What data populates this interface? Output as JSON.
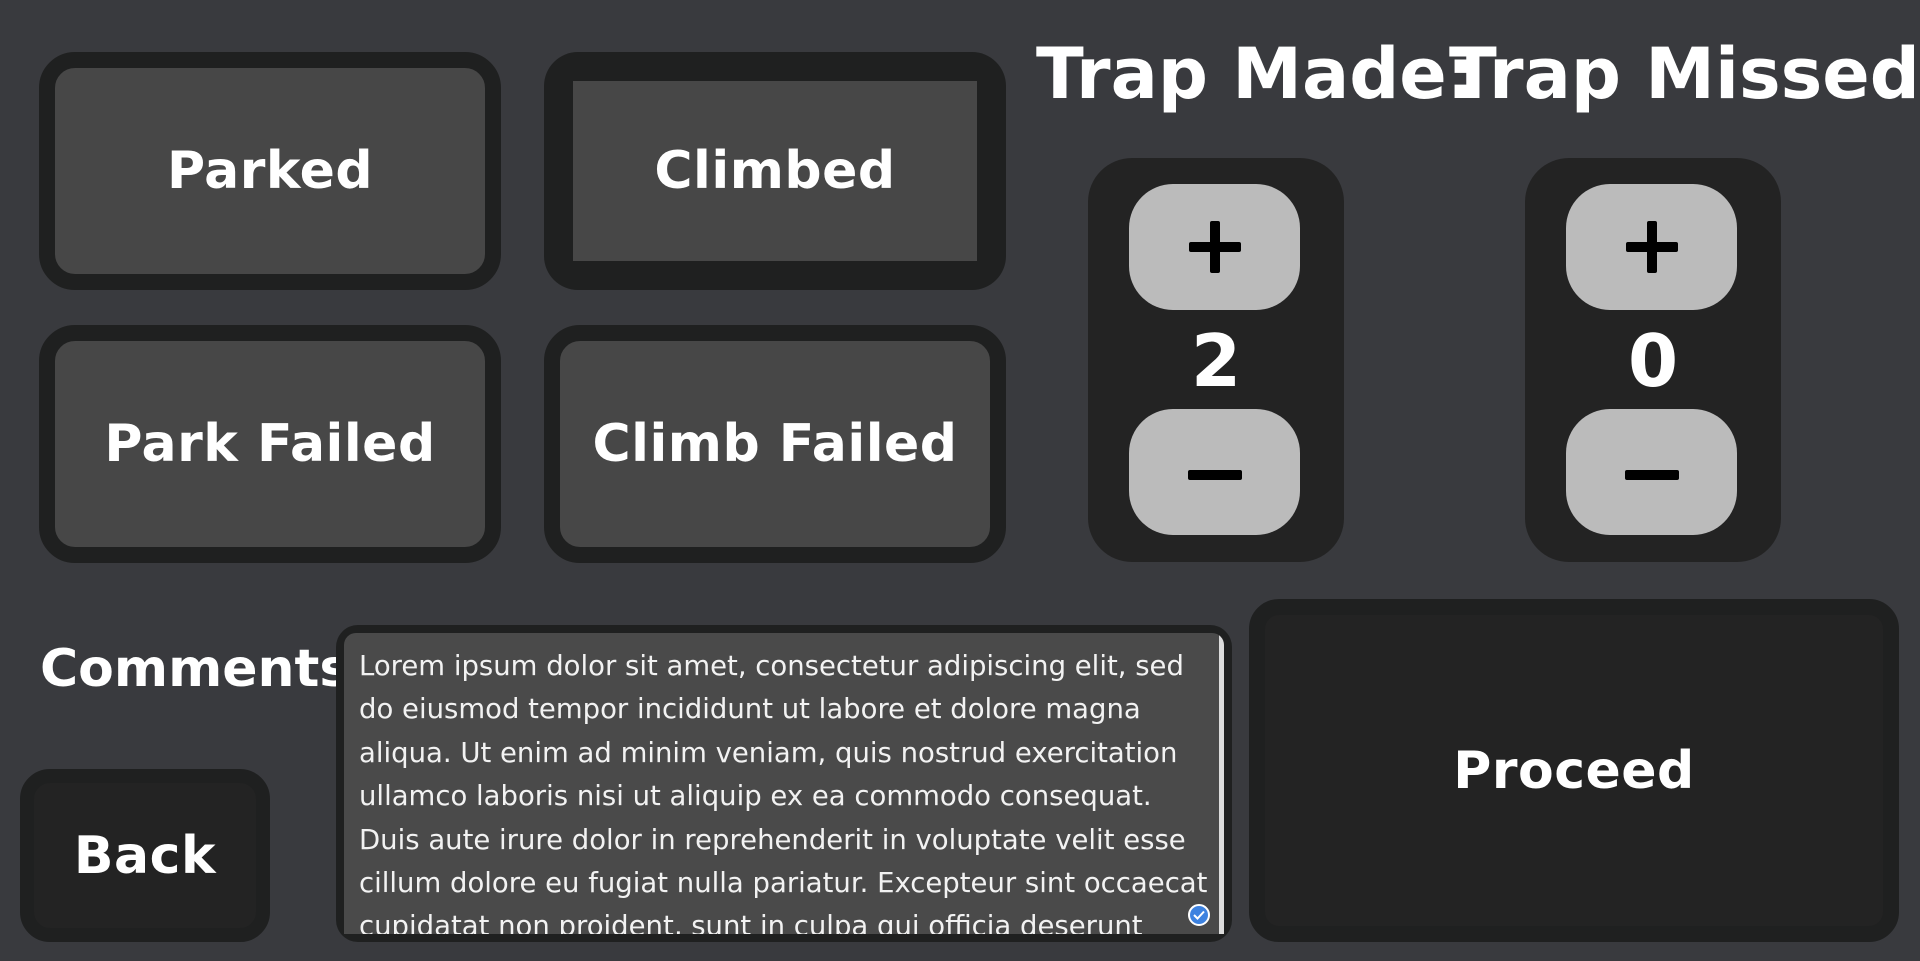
{
  "status_buttons": {
    "parked": "Parked",
    "climbed": "Climbed",
    "park_failed": "Park Failed",
    "climb_failed": "Climb Failed",
    "selected": "Climbed"
  },
  "trap_made": {
    "label": "Trap Made:",
    "plus": "+",
    "minus": "−",
    "value": "2"
  },
  "trap_missed": {
    "label": "Trap Missed:",
    "plus": "+",
    "minus": "−",
    "value": "0"
  },
  "comments": {
    "label": "Comments:",
    "text": "Lorem ipsum dolor sit amet, consectetur adipiscing elit, sed do eiusmod tempor incididunt ut labore et dolore magna aliqua. Ut enim ad minim veniam, quis nostrud exercitation ullamco laboris nisi ut aliquip ex ea commodo consequat. Duis aute irure dolor in reprehenderit in voluptate velit esse cillum dolore eu fugiat nulla pariatur. Excepteur sint occaecat cupidatat non proident, sunt in culpa qui officia deserunt mollit anim id est laborum."
  },
  "navigation": {
    "back": "Back",
    "proceed": "Proceed"
  },
  "colors": {
    "background": "#393a3e",
    "button_face": "#474747",
    "button_border": "#1f2020",
    "counter_panel": "#232323",
    "counter_button": "#bbbbbb",
    "check_badge": "#3d82e0"
  },
  "icons": {
    "increment": "plus-icon",
    "decrement": "minus-icon",
    "spellcheck": "check-circle-icon"
  }
}
